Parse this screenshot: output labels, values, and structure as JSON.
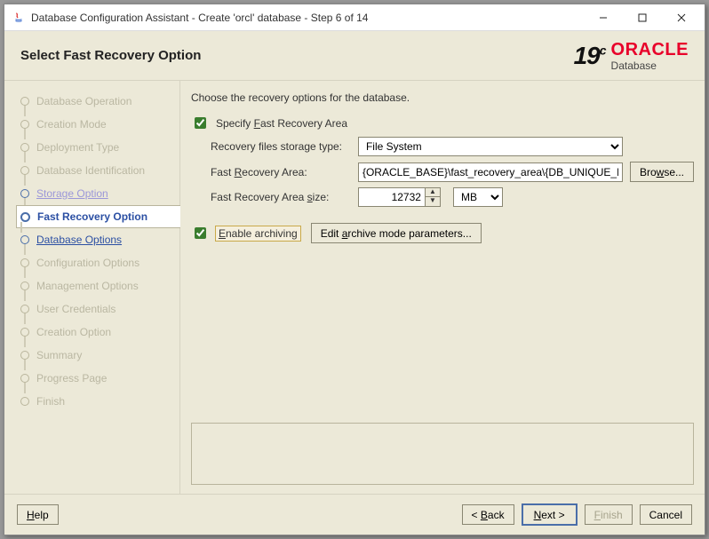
{
  "window": {
    "title": "Database Configuration Assistant - Create 'orcl' database - Step 6 of 14"
  },
  "header": {
    "page_title": "Select Fast Recovery Option",
    "version": "19",
    "version_suffix": "c",
    "brand": "ORACLE",
    "product": "Database"
  },
  "sidebar": {
    "items": [
      {
        "label": "Database Operation",
        "state": "dim"
      },
      {
        "label": "Creation Mode",
        "state": "dim"
      },
      {
        "label": "Deployment Type",
        "state": "dim"
      },
      {
        "label": "Database Identification",
        "state": "dim"
      },
      {
        "label": "Storage Option",
        "state": "visited"
      },
      {
        "label": "Fast Recovery Option",
        "state": "active"
      },
      {
        "label": "Database Options",
        "state": "next"
      },
      {
        "label": "Configuration Options",
        "state": "dim"
      },
      {
        "label": "Management Options",
        "state": "dim"
      },
      {
        "label": "User Credentials",
        "state": "dim"
      },
      {
        "label": "Creation Option",
        "state": "dim"
      },
      {
        "label": "Summary",
        "state": "dim"
      },
      {
        "label": "Progress Page",
        "state": "dim"
      },
      {
        "label": "Finish",
        "state": "dim"
      }
    ]
  },
  "form": {
    "instruction": "Choose the recovery options for the database.",
    "specify_fra_label": "Specify Fast Recovery Area",
    "specify_fra_checked": true,
    "storage_type_label": "Recovery files storage type:",
    "storage_type_value": "File System",
    "fra_label": "Fast Recovery Area:",
    "fra_value": "{ORACLE_BASE}\\fast_recovery_area\\{DB_UNIQUE_NAME}",
    "browse_label": "Browse...",
    "size_label": "Fast Recovery Area size:",
    "size_value": "12732",
    "size_unit": "MB",
    "enable_arch_label": "Enable archiving",
    "enable_arch_checked": true,
    "edit_arch_label": "Edit archive mode parameters..."
  },
  "footer": {
    "help": "Help",
    "back": "< Back",
    "next": "Next >",
    "finish": "Finish",
    "cancel": "Cancel"
  }
}
